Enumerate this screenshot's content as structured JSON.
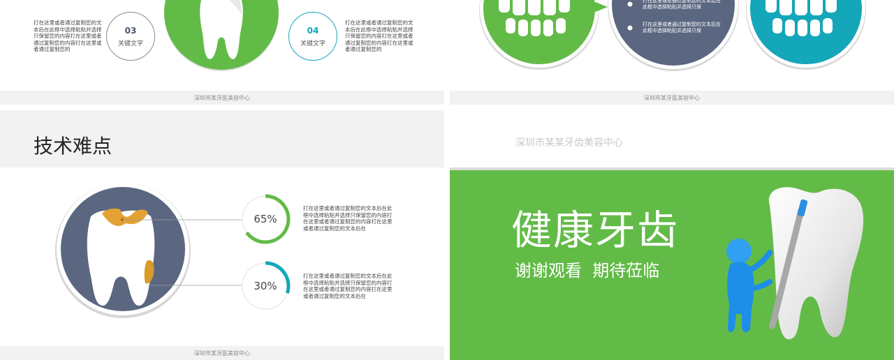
{
  "colors": {
    "green": "#62bb47",
    "teal": "#14a6b9",
    "slate": "#5b6781",
    "gray_bg": "#f2f2f2",
    "orange": "#e3a233"
  },
  "slide_top_left": {
    "left_text": "打在这里或者通过复制您的文本后在此框中选择粘贴并选择只保留您的内容打在这里或者通过复制您的内容打在这里或者通过复制您的",
    "left_circle": {
      "number": "03",
      "label": "关键文字"
    },
    "right_circle": {
      "number": "04",
      "label": "关键文字"
    },
    "right_text": "打在这里或者通过复制您的文本后在此框中选择粘贴并选择只保留您的内容打在这里或者通过复制您的内容打在这里或者通过复制您的",
    "footer": "深圳市某牙医美容中心",
    "icon": "tooth-icon"
  },
  "slide_top_right": {
    "bullet_1": "打在这里或者通过复制您的文本后在此框中选择粘贴并选择只保",
    "bullet_2": "打在这里或者通过复制您的文本后在此框中选择粘贴并选择只保",
    "footer": "深圳市某牙医美容中心",
    "icons": [
      "teeth-icon",
      "teeth-icon"
    ]
  },
  "slide_bottom_left": {
    "title": "技术难点",
    "stats": [
      {
        "percent": 65,
        "label": "65%",
        "text": "打在这里或者通过复制您的文本后在此框中选择粘贴并选择只保留您的内容打在这里或者通过复制您的内容打在这里或者通过复制您的文本后在"
      },
      {
        "percent": 30,
        "label": "30%",
        "text": "打在这里或者通过复制您的文本后在此框中选择粘贴并选择只保留您的内容打在这里或者通过复制您的内容打在这里或者通过复制您的文本后在"
      }
    ],
    "footer": "深圳市某牙医美容中心",
    "icon": "decayed-tooth-icon"
  },
  "slide_bottom_right": {
    "header_text": "深圳市某某牙齿美容中心",
    "title": "健康牙齿",
    "subtitle": "谢谢观看  期待莅临",
    "icons": [
      "tooth-icon",
      "figure-with-toothbrush-icon"
    ]
  }
}
